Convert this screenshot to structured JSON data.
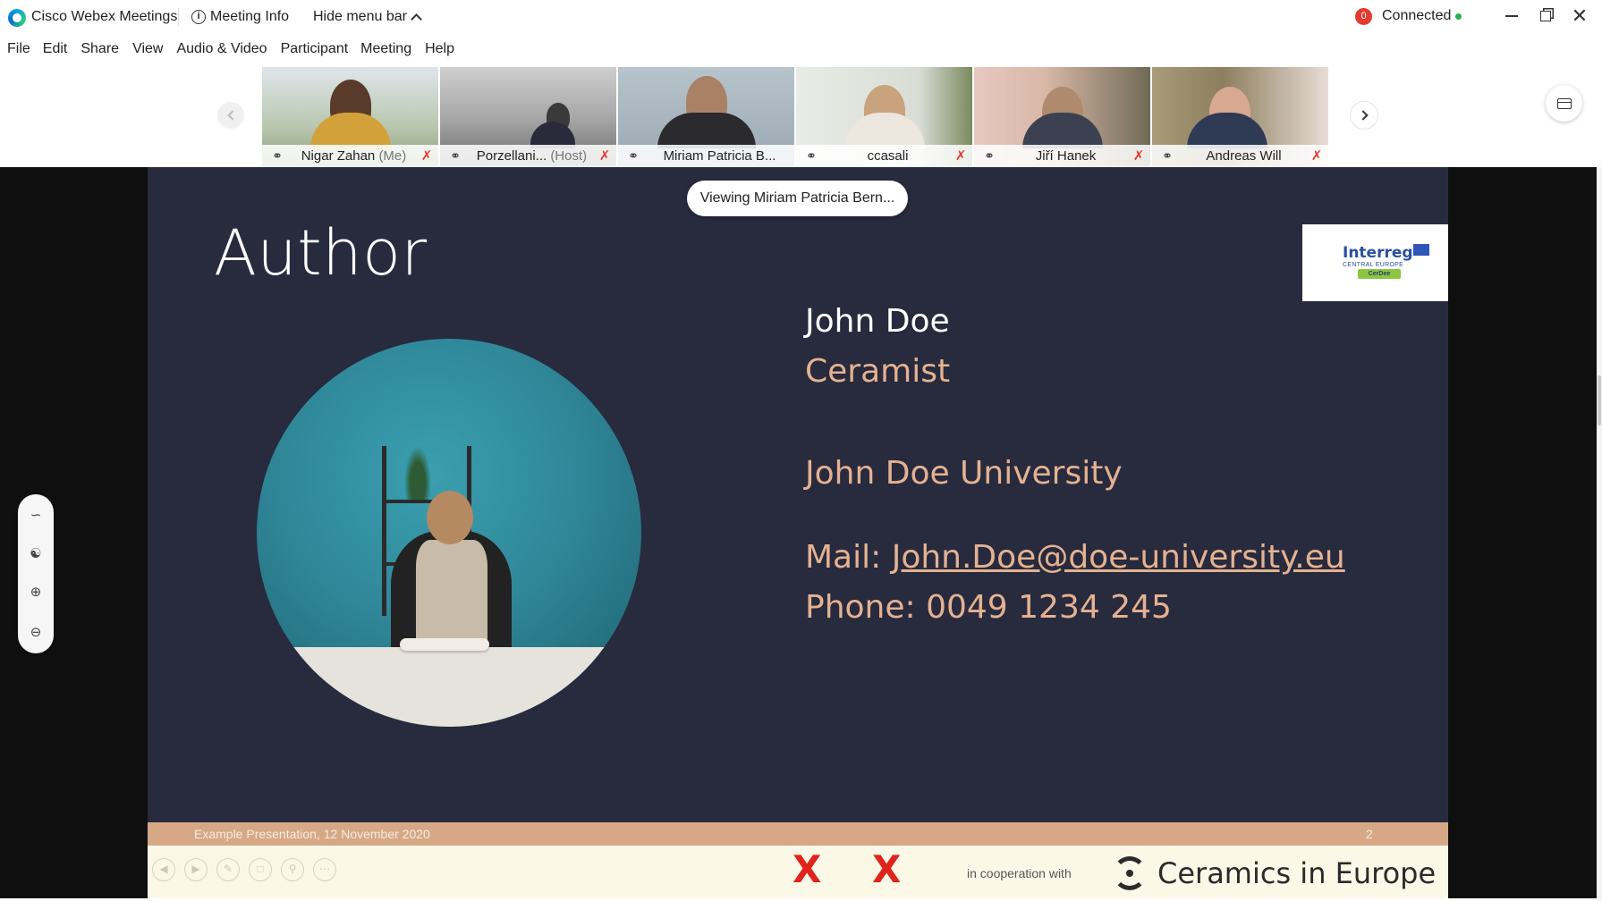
{
  "titlebar": {
    "app_title": "Cisco Webex Meetings",
    "meeting_info": "Meeting Info",
    "hide_menu_bar": "Hide menu bar",
    "connection_badge": "0",
    "connection_status": "Connected",
    "minimize": "—",
    "close": "✕"
  },
  "menu": [
    "File",
    "Edit",
    "Share",
    "View",
    "Audio & Video",
    "Participant",
    "Meeting",
    "Help"
  ],
  "participants": [
    {
      "name": "Nigar Zahan",
      "role": "(Me)",
      "muted": true,
      "active": false
    },
    {
      "name": "Porzellani...",
      "role": "(Host)",
      "muted": true,
      "active": false
    },
    {
      "name": "Miriam Patricia B...",
      "role": "",
      "muted": false,
      "active": true
    },
    {
      "name": "ccasali",
      "role": "",
      "muted": true,
      "active": false
    },
    {
      "name": "Jiří Hanek",
      "role": "",
      "muted": true,
      "active": false
    },
    {
      "name": "Andreas Will",
      "role": "",
      "muted": true,
      "active": false
    }
  ],
  "viewing_label": "Viewing Miriam Patricia Bern...",
  "slide": {
    "title": "Author",
    "logo_text": "Interreg",
    "logo_sub": "CENTRAL EUROPE",
    "logo_ribbon": "CerDee",
    "name": "John Doe",
    "role": "Ceramist",
    "university": "John Doe University",
    "mail_label": "Mail: ",
    "mail": "John.Doe@doe-university.eu",
    "phone": "Phone: 0049 1234 245",
    "footer_text": "Example Presentation, 12 November 2020",
    "page_number": "2",
    "red_mark": "X",
    "cooperation_label": "in cooperation with",
    "partner_name": "Ceramics in Europe"
  },
  "colors": {
    "slide_bg": "#282a3e",
    "accent_text": "#e4b290",
    "active_thumb_border": "#1ab3e6",
    "footer_bar": "#d6a886",
    "mute_red": "#e33b2f"
  }
}
